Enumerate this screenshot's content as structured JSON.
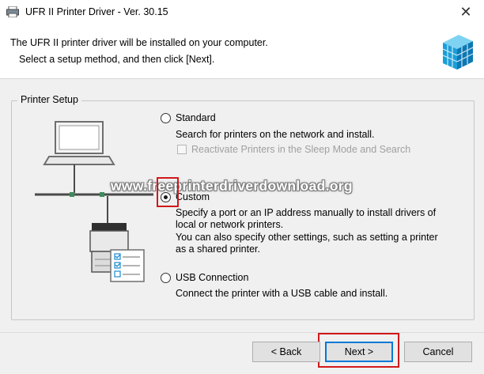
{
  "window": {
    "title": "UFR II Printer Driver - Ver. 30.15",
    "close_symbol": "✕",
    "icon": "printer-icon"
  },
  "header": {
    "line1": "The UFR II printer driver will be installed on your computer.",
    "line2": "Select a setup method, and then click [Next]."
  },
  "setup": {
    "group_label": "Printer Setup",
    "options": [
      {
        "label": "Standard",
        "selected": false,
        "description": [
          "Search for printers on the network and install."
        ],
        "checkbox": {
          "label": "Reactivate Printers in the Sleep Mode and Search",
          "checked": false,
          "enabled": false
        }
      },
      {
        "label": "Custom",
        "selected": true,
        "description": [
          "Specify a port or an IP address manually to install drivers of",
          "local or network printers.",
          "You can also specify other settings, such as setting a printer",
          "as a shared printer."
        ]
      },
      {
        "label": "USB Connection",
        "selected": false,
        "description": [
          "Connect the printer with a USB cable and install."
        ]
      }
    ]
  },
  "watermark": "www.freeprinterdriverdownload.org",
  "buttons": {
    "back": "< Back",
    "next": "Next >",
    "cancel": "Cancel"
  },
  "colors": {
    "highlight": "#d0191a",
    "accent": "#0078d7"
  }
}
